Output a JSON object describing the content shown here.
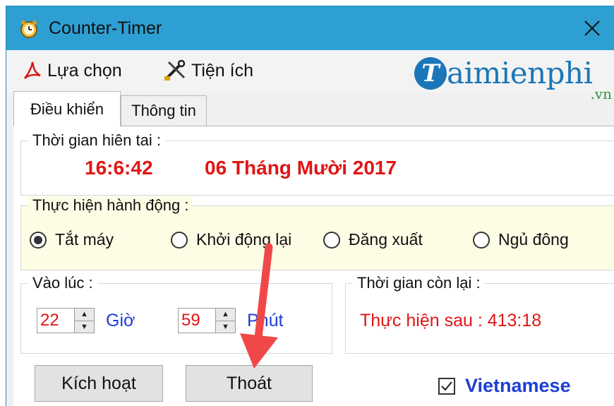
{
  "window": {
    "title": "Counter-Timer",
    "accent_color": "#2e9fd2",
    "icon": "alarm-clock-icon"
  },
  "menu": {
    "items": [
      {
        "label": "Lựa chọn",
        "icon": "acrobat-icon"
      },
      {
        "label": "Tiện ích",
        "icon": "tools-icon"
      }
    ]
  },
  "logo": {
    "initial": "T",
    "text": "aimienphi",
    "suffix": ".vn"
  },
  "tabs": [
    {
      "label": "Điều khiển",
      "selected": true
    },
    {
      "label": "Thông tin",
      "selected": false
    }
  ],
  "current_time": {
    "label": "Thời gian hiên tai :",
    "time": "16:6:42",
    "date": "06 Tháng Mười 2017"
  },
  "action": {
    "label": "Thực hiện hành động :",
    "options": [
      {
        "label": "Tắt máy",
        "selected": true
      },
      {
        "label": "Khởi động lại",
        "selected": false
      },
      {
        "label": "Đăng xuất",
        "selected": false
      },
      {
        "label": "Ngủ đông",
        "selected": false
      }
    ]
  },
  "schedule": {
    "label": "Vào lúc :",
    "hour_value": "22",
    "hour_unit": "Giờ",
    "minute_value": "59",
    "minute_unit": "Phút"
  },
  "remaining": {
    "label": "Thời gian còn lại :",
    "text": "Thực hiện sau : 413:18"
  },
  "buttons": {
    "activate": "Kích hoạt",
    "exit": "Thoát"
  },
  "language": {
    "label": "Vietnamese",
    "checked": true
  },
  "colors": {
    "time_red": "#e01515",
    "unit_blue": "#1d3fd4",
    "action_bg": "#fdfde6",
    "annotation_arrow": "#f04848"
  }
}
